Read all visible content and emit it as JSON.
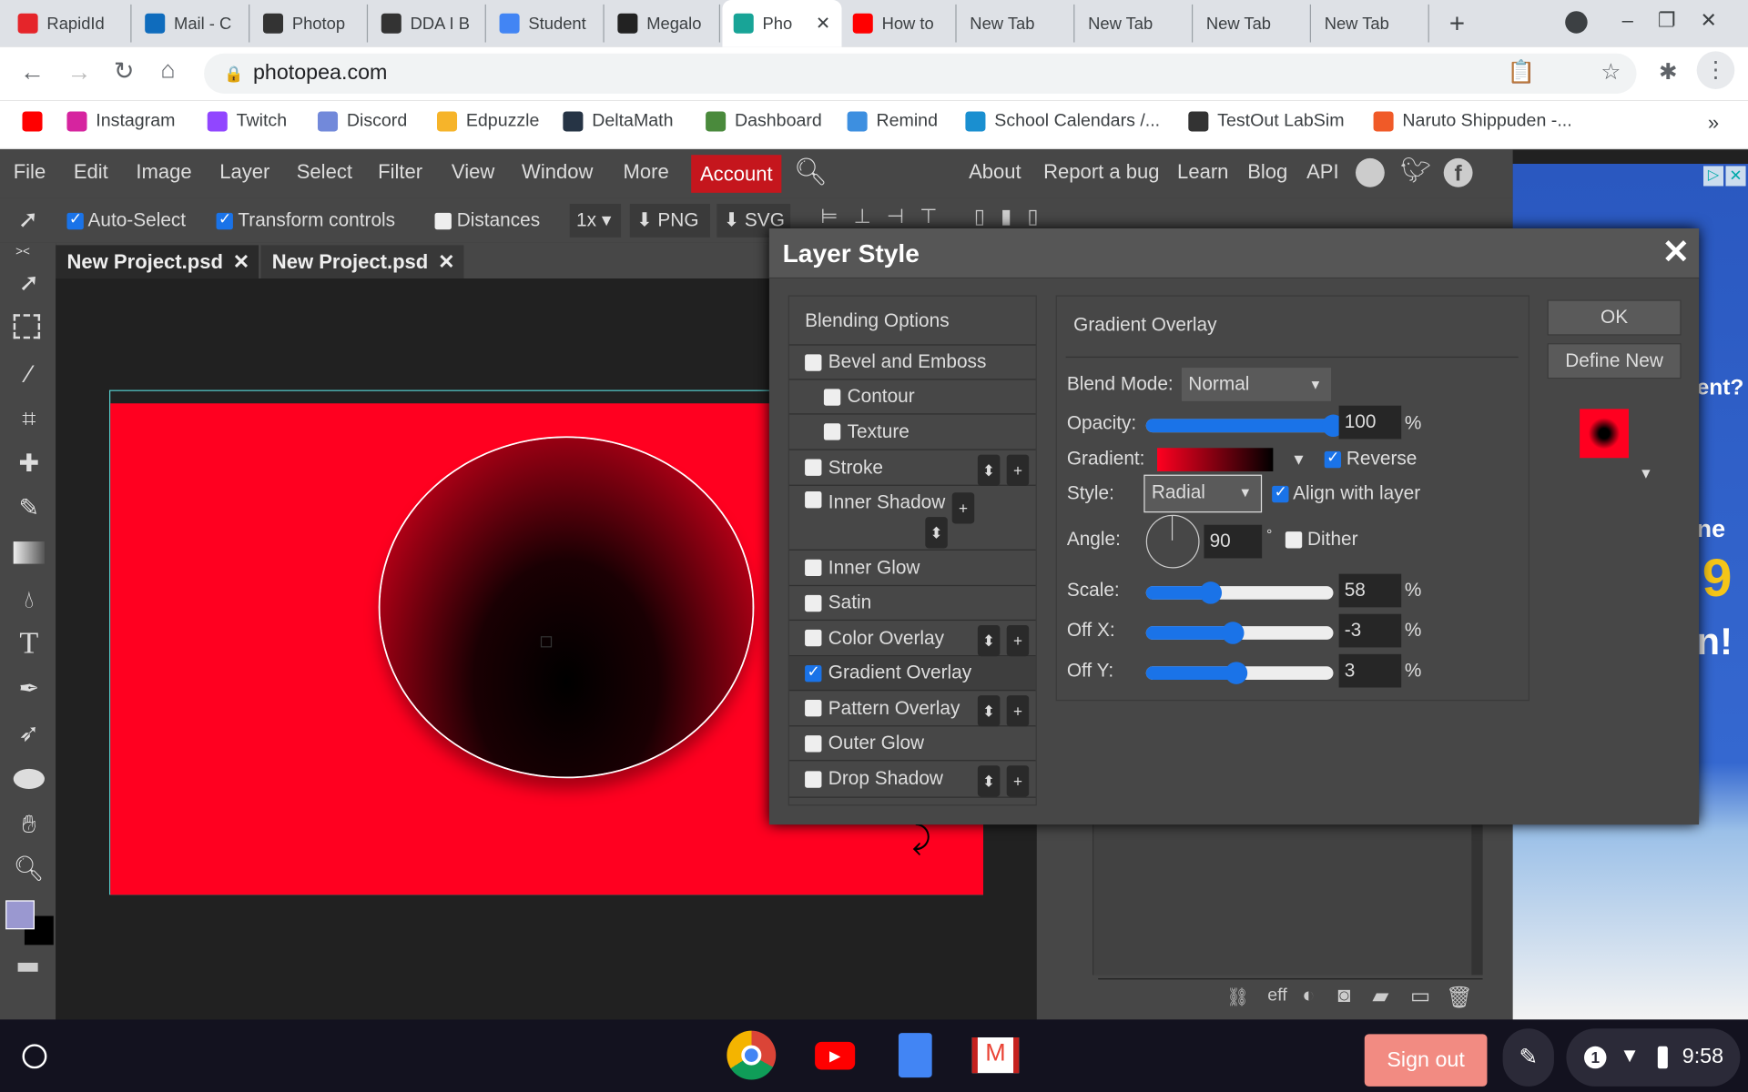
{
  "browser": {
    "tabs": [
      {
        "label": "RapidId",
        "color": "#e5252a"
      },
      {
        "label": "Mail - C",
        "color": "#0f6cbd"
      },
      {
        "label": "Photop",
        "color": "#333"
      },
      {
        "label": "DDA I B",
        "color": "#333"
      },
      {
        "label": "Student",
        "color": "#4285f4"
      },
      {
        "label": "Megalo",
        "color": "#222"
      },
      {
        "label": "Pho",
        "color": "#18a497",
        "active": true
      },
      {
        "label": "How to",
        "color": "#ff0000"
      },
      {
        "label": "New Tab"
      },
      {
        "label": "New Tab"
      },
      {
        "label": "New Tab"
      },
      {
        "label": "New Tab"
      }
    ],
    "url": "photopea.com",
    "bookmarks": [
      {
        "label": "",
        "color": "#ff0000"
      },
      {
        "label": "Instagram",
        "color": "#d6249f"
      },
      {
        "label": "Twitch",
        "color": "#9146ff"
      },
      {
        "label": "Discord",
        "color": "#7289da"
      },
      {
        "label": "Edpuzzle",
        "color": "#f6b42a"
      },
      {
        "label": "DeltaMath",
        "color": "#263445"
      },
      {
        "label": "Dashboard",
        "color": "#4a8a3c"
      },
      {
        "label": "Remind",
        "color": "#3d8fe0"
      },
      {
        "label": "School Calendars /...",
        "color": "#1a8fd0"
      },
      {
        "label": "TestOut LabSim",
        "color": "#333"
      },
      {
        "label": "Naruto Shippuden -...",
        "color": "#f05a28"
      }
    ],
    "more": "»"
  },
  "menu": {
    "items": [
      "File",
      "Edit",
      "Image",
      "Layer",
      "Select",
      "Filter",
      "View",
      "Window",
      "More"
    ],
    "account": "Account",
    "right": [
      "About",
      "Report a bug",
      "Learn",
      "Blog",
      "API"
    ],
    "accent": "#c5161d"
  },
  "options": {
    "auto_select": "Auto-Select",
    "transform": "Transform controls",
    "distances": "Distances",
    "zoom": "1x",
    "png": "PNG",
    "svg": "SVG"
  },
  "doc_tabs": [
    "New Project.psd",
    "New Project.psd"
  ],
  "dialog": {
    "title": "Layer Style",
    "list": [
      {
        "label": "Blending Options",
        "header": true
      },
      {
        "label": "Bevel and Emboss",
        "checked": false
      },
      {
        "label": "Contour",
        "checked": false,
        "sub": true
      },
      {
        "label": "Texture",
        "checked": false,
        "sub": true
      },
      {
        "label": "Stroke",
        "checked": false
      },
      {
        "label": "Inner Shadow",
        "checked": false
      },
      {
        "label": "Inner Glow",
        "checked": false
      },
      {
        "label": "Satin",
        "checked": false
      },
      {
        "label": "Color Overlay",
        "checked": false
      },
      {
        "label": "Gradient Overlay",
        "checked": true
      },
      {
        "label": "Pattern Overlay",
        "checked": false
      },
      {
        "label": "Outer Glow",
        "checked": false
      },
      {
        "label": "Drop Shadow",
        "checked": false
      }
    ],
    "section": "Gradient Overlay",
    "blend_mode_label": "Blend Mode:",
    "blend_mode": "Normal",
    "opacity_label": "Opacity:",
    "opacity": "100",
    "gradient_label": "Gradient:",
    "reverse": "Reverse",
    "reverse_checked": true,
    "style_label": "Style:",
    "style": "Radial",
    "align": "Align with layer",
    "align_checked": true,
    "angle_label": "Angle:",
    "angle": "90",
    "degree": "°",
    "dither": "Dither",
    "dither_checked": false,
    "scale_label": "Scale:",
    "scale": "58",
    "offx_label": "Off X:",
    "offx": "-3",
    "offy_label": "Off Y:",
    "offy": "3",
    "percent": "%",
    "ok": "OK",
    "define_new": "Define New",
    "gradient_colors": [
      "#ff0020",
      "#000000"
    ]
  },
  "ad_text": [
    "ent?",
    "ne",
    "9",
    "n!"
  ],
  "layers_footer": {
    "eff": "eff"
  },
  "taskbar": {
    "sign_out": "Sign out",
    "notif": "1",
    "time": "9:58"
  }
}
